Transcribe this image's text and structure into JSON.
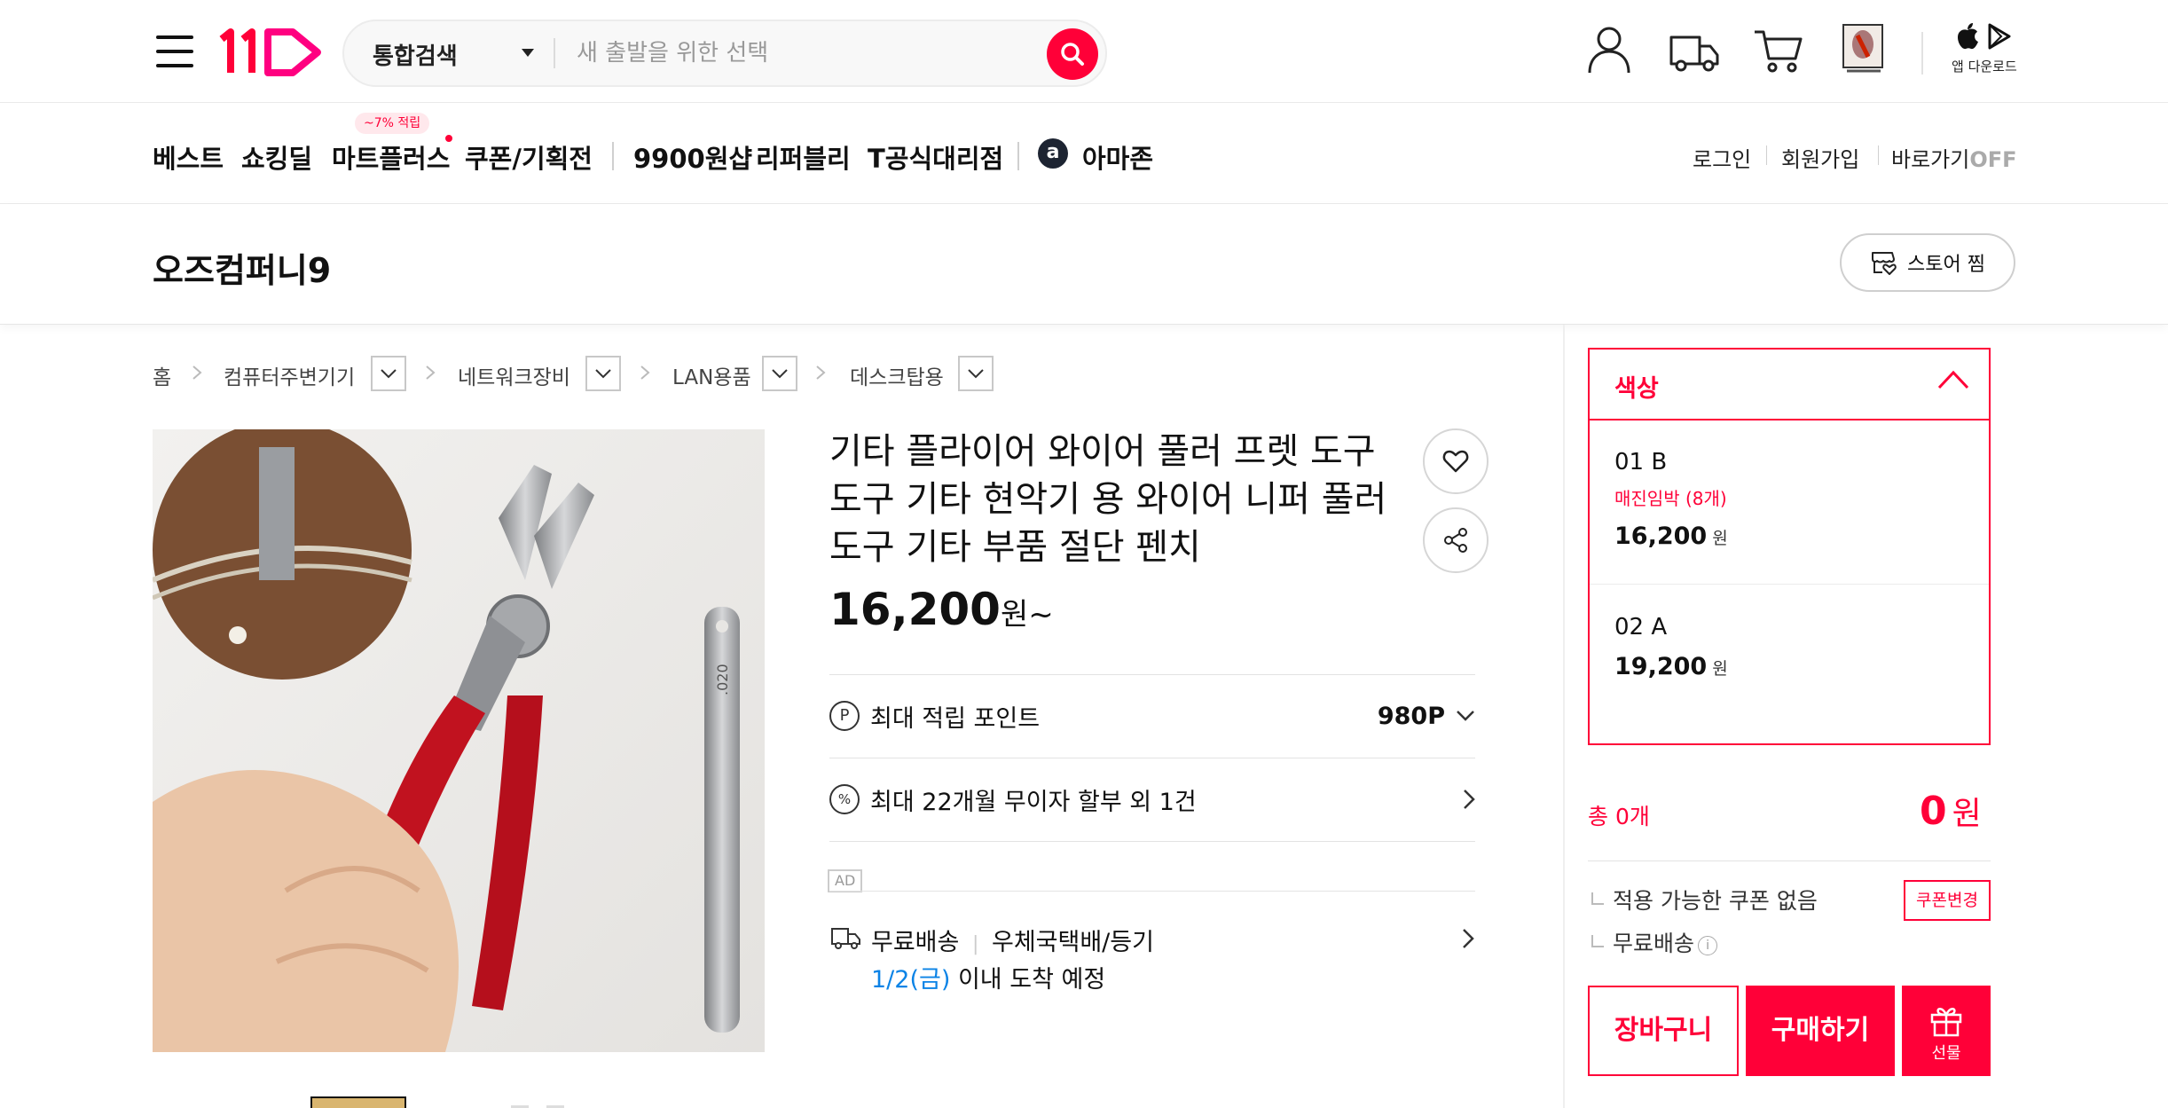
{
  "header": {
    "search_category": "통합검색",
    "search_placeholder": "새 출발을 위한 선택",
    "app_download_label": "앱 다운로드"
  },
  "nav": {
    "items": [
      "베스트",
      "쇼킹딜",
      "마트플러스",
      "쿠폰/기획전",
      "9900원샵",
      "리퍼블리",
      "T공식대리점",
      "아마존"
    ],
    "badge": "~7% 적립",
    "amazon_letter": "a",
    "login": "로그인",
    "signup": "회원가입",
    "shortcut": "바로가기",
    "shortcut_state": "OFF"
  },
  "store": {
    "name": "오즈컴퍼니9",
    "follow_label": "스토어 찜"
  },
  "breadcrumb": [
    "홈",
    "컴퓨터주변기기",
    "네트워크장비",
    "LAN용품",
    "데스크탑용"
  ],
  "product": {
    "title": "기타 플라이어 와이어 풀러 프렛 도구 도구 기타 현악기 용 와이어 니퍼 풀러 도구 기타 부품 절단 펜치",
    "price": "16,200",
    "price_unit": "원~",
    "image_ruler_text": ".020",
    "points_icon": "P",
    "points_label": "최대 적립 포인트",
    "points_value": "980P",
    "installment_icon": "%",
    "installment_label": "최대 22개월 무이자 할부 외 1건",
    "ad_tag": "AD",
    "shipping_free": "무료배송",
    "shipping_method": "우체국택배/등기",
    "delivery_date": "1/2(금)",
    "delivery_suffix": "이내 도착 예정"
  },
  "options": {
    "header": "색상",
    "items": [
      {
        "name": "01 B",
        "stock": "매진임박 (8개)",
        "price": "16,200",
        "unit": "원"
      },
      {
        "name": "02 A",
        "price": "19,200",
        "unit": "원"
      }
    ]
  },
  "summary": {
    "total_label": "총 0개",
    "total_price": "0",
    "total_unit": "원",
    "coupon_text": "적용 가능한 쿠폰 없음",
    "coupon_button": "쿠폰변경",
    "shipping_text": "무료배송",
    "info_glyph": "i"
  },
  "actions": {
    "cart": "장바구니",
    "buy": "구매하기",
    "gift": "선물"
  },
  "colors": {
    "accent": "#ff0038",
    "delivery_date": "#0b83e6",
    "logo_pink": "#ff0038"
  },
  "icons": [
    "menu-icon",
    "search-icon",
    "user-icon",
    "delivery-truck-icon",
    "cart-icon",
    "recent-item-icon",
    "apple-icon",
    "play-store-icon",
    "store-heart-icon",
    "chevron-right-icon",
    "chevron-down-icon",
    "heart-icon",
    "share-icon",
    "chevron-up-icon",
    "gift-icon"
  ]
}
